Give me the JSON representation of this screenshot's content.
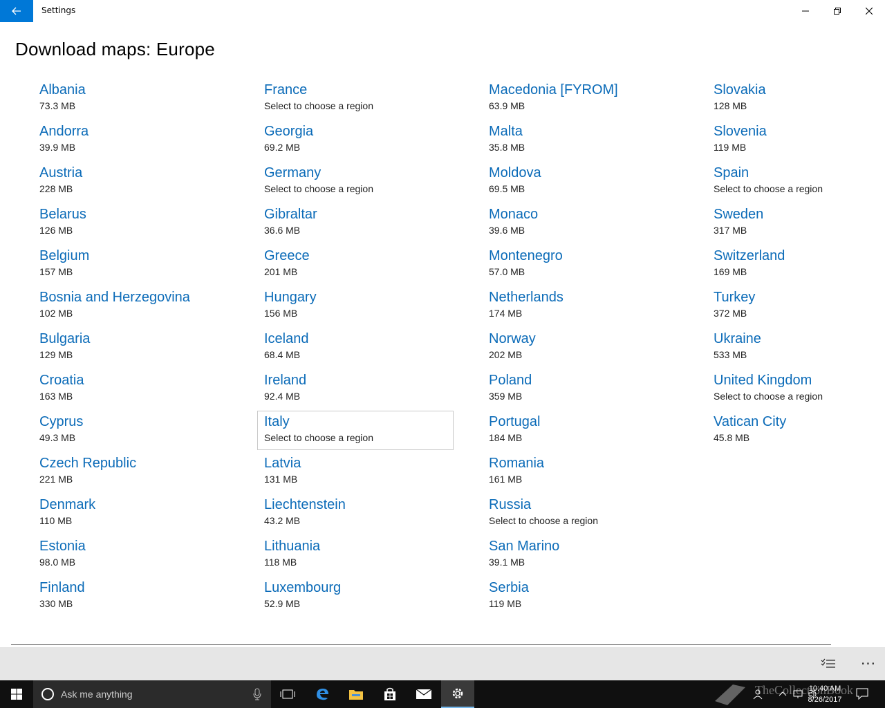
{
  "window": {
    "title": "Settings"
  },
  "page": {
    "title": "Download maps: Europe"
  },
  "countries": [
    {
      "name": "Albania",
      "size": "73.3 MB"
    },
    {
      "name": "Andorra",
      "size": "39.9 MB"
    },
    {
      "name": "Austria",
      "size": "228 MB"
    },
    {
      "name": "Belarus",
      "size": "126 MB"
    },
    {
      "name": "Belgium",
      "size": "157 MB"
    },
    {
      "name": "Bosnia and Herzegovina",
      "size": "102 MB"
    },
    {
      "name": "Bulgaria",
      "size": "129 MB"
    },
    {
      "name": "Croatia",
      "size": "163 MB"
    },
    {
      "name": "Cyprus",
      "size": "49.3 MB"
    },
    {
      "name": "Czech Republic",
      "size": "221 MB"
    },
    {
      "name": "Denmark",
      "size": "110 MB"
    },
    {
      "name": "Estonia",
      "size": "98.0 MB"
    },
    {
      "name": "Finland",
      "size": "330 MB"
    },
    {
      "name": "France",
      "size": "Select to choose a region"
    },
    {
      "name": "Georgia",
      "size": "69.2 MB"
    },
    {
      "name": "Germany",
      "size": "Select to choose a region"
    },
    {
      "name": "Gibraltar",
      "size": "36.6 MB"
    },
    {
      "name": "Greece",
      "size": "201 MB"
    },
    {
      "name": "Hungary",
      "size": "156 MB"
    },
    {
      "name": "Iceland",
      "size": "68.4 MB"
    },
    {
      "name": "Ireland",
      "size": "92.4 MB"
    },
    {
      "name": "Italy",
      "size": "Select to choose a region",
      "focused": true
    },
    {
      "name": "Latvia",
      "size": "131 MB"
    },
    {
      "name": "Liechtenstein",
      "size": "43.2 MB"
    },
    {
      "name": "Lithuania",
      "size": "118 MB"
    },
    {
      "name": "Luxembourg",
      "size": "52.9 MB"
    },
    {
      "name": "Macedonia [FYROM]",
      "size": "63.9 MB"
    },
    {
      "name": "Malta",
      "size": "35.8 MB"
    },
    {
      "name": "Moldova",
      "size": "69.5 MB"
    },
    {
      "name": "Monaco",
      "size": "39.6 MB"
    },
    {
      "name": "Montenegro",
      "size": "57.0 MB"
    },
    {
      "name": "Netherlands",
      "size": "174 MB"
    },
    {
      "name": "Norway",
      "size": "202 MB"
    },
    {
      "name": "Poland",
      "size": "359 MB"
    },
    {
      "name": "Portugal",
      "size": "184 MB"
    },
    {
      "name": "Romania",
      "size": "161 MB"
    },
    {
      "name": "Russia",
      "size": "Select to choose a region"
    },
    {
      "name": "San Marino",
      "size": "39.1 MB"
    },
    {
      "name": "Serbia",
      "size": "119 MB"
    },
    {
      "name": "Slovakia",
      "size": "128 MB"
    },
    {
      "name": "Slovenia",
      "size": "119 MB"
    },
    {
      "name": "Spain",
      "size": "Select to choose a region"
    },
    {
      "name": "Sweden",
      "size": "317 MB"
    },
    {
      "name": "Switzerland",
      "size": "169 MB"
    },
    {
      "name": "Turkey",
      "size": "372 MB"
    },
    {
      "name": "Ukraine",
      "size": "533 MB"
    },
    {
      "name": "United Kingdom",
      "size": "Select to choose a region"
    },
    {
      "name": "Vatican City",
      "size": "45.8 MB"
    }
  ],
  "commandbar": {
    "select_icon": "select-list-icon",
    "more_label": "···"
  },
  "taskbar": {
    "search_placeholder": "Ask me anything",
    "clock_time": "10:40 AM",
    "clock_date": "8/26/2017",
    "watermark": "TheCollectionBook",
    "icons": [
      "windows-start-icon",
      "cortana-icon",
      "microphone-icon",
      "task-view-icon",
      "edge-icon",
      "file-explorer-icon",
      "store-icon",
      "mail-icon",
      "settings-icon"
    ]
  },
  "colors": {
    "accent": "#0078d7",
    "link": "#0b6bb8",
    "taskbar": "#101010",
    "commandbar": "#e6e6e6"
  }
}
